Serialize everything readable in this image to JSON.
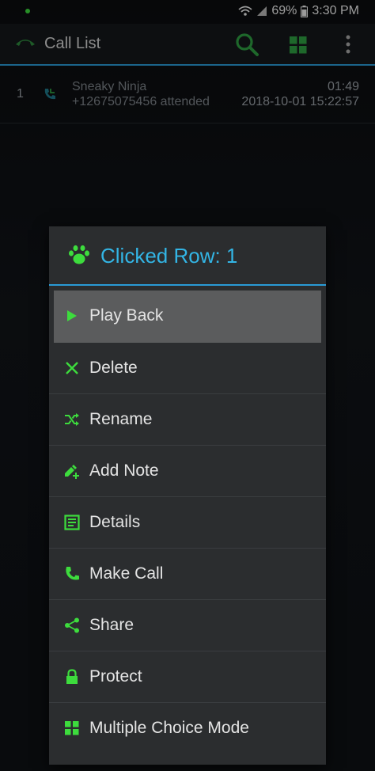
{
  "status_bar": {
    "battery_percent": "69%",
    "time": "3:30 PM"
  },
  "app_bar": {
    "title": "Call List"
  },
  "call_list": [
    {
      "index": "1",
      "name": "Sneaky Ninja",
      "subtitle": "+12675075456 attended",
      "duration": "01:49",
      "datetime": "2018-10-01 15:22:57"
    }
  ],
  "dialog": {
    "title": "Clicked Row: 1",
    "items": [
      {
        "label": "Play Back",
        "icon": "play-icon"
      },
      {
        "label": "Delete",
        "icon": "close-icon"
      },
      {
        "label": "Rename",
        "icon": "shuffle-icon"
      },
      {
        "label": "Add Note",
        "icon": "edit-add-icon"
      },
      {
        "label": "Details",
        "icon": "details-icon"
      },
      {
        "label": "Make Call",
        "icon": "phone-icon"
      },
      {
        "label": "Share",
        "icon": "share-icon"
      },
      {
        "label": "Protect",
        "icon": "lock-icon"
      },
      {
        "label": "Multiple Choice Mode",
        "icon": "grid-icon"
      }
    ]
  },
  "colors": {
    "accent": "#33b5e5",
    "icon_green": "#3ddc3d"
  }
}
